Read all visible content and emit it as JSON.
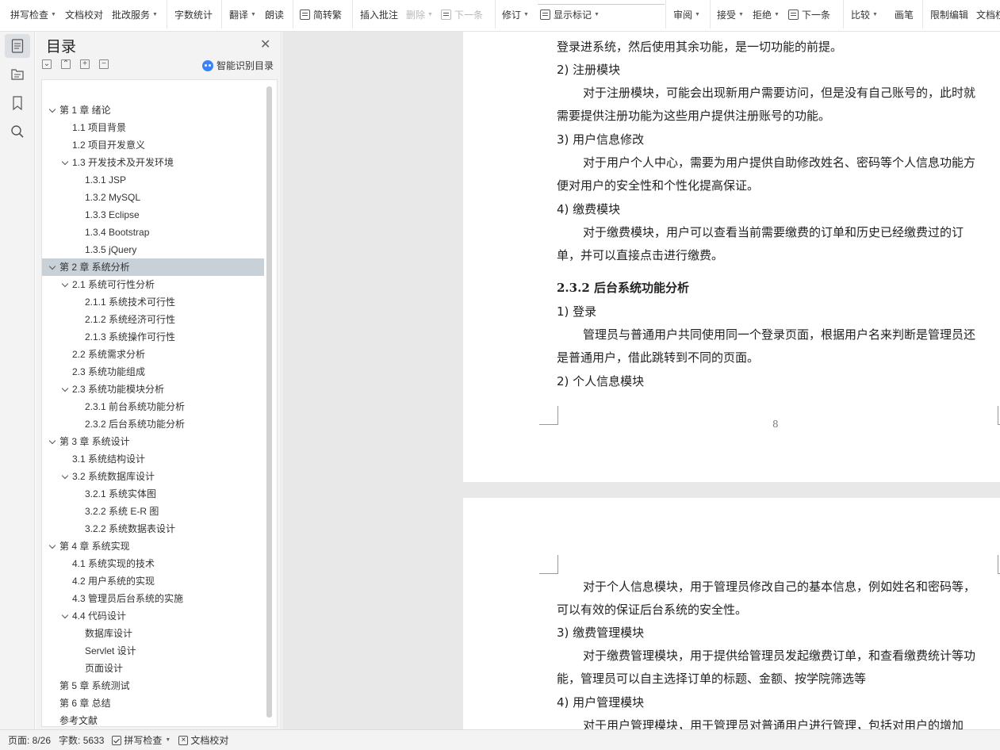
{
  "toolbar": {
    "items": [
      {
        "label": "拼写检查",
        "caret": true,
        "disabled": false
      },
      {
        "label": "文档校对",
        "caret": false,
        "disabled": false
      },
      {
        "label": "批改服务",
        "caret": true,
        "disabled": false
      },
      {
        "label": "字数统计",
        "caret": false,
        "disabled": false
      },
      {
        "label": "翻译",
        "caret": true,
        "disabled": false
      },
      {
        "label": "朗读",
        "caret": false,
        "disabled": false
      },
      {
        "label": "简转繁",
        "caret": false,
        "disabled": false
      },
      {
        "label": "插入批注",
        "caret": false,
        "disabled": false
      },
      {
        "label": "删除",
        "caret": true,
        "disabled": true
      },
      {
        "label": "下一条",
        "caret": false,
        "disabled": true
      },
      {
        "label": "修订",
        "caret": true,
        "disabled": false
      },
      {
        "label": "显示标记",
        "caret": true,
        "disabled": false
      },
      {
        "label": "审阅",
        "caret": true,
        "disabled": false
      },
      {
        "label": "接受",
        "caret": true,
        "disabled": false
      },
      {
        "label": "拒绝",
        "caret": true,
        "disabled": false
      },
      {
        "label": "下一条",
        "caret": false,
        "disabled": false
      },
      {
        "label": "比较",
        "caret": true,
        "disabled": false
      },
      {
        "label": "画笔",
        "caret": false,
        "disabled": false
      },
      {
        "label": "限制编辑",
        "caret": false,
        "disabled": false
      },
      {
        "label": "文档权",
        "caret": false,
        "disabled": false
      }
    ]
  },
  "rail": {
    "icons": [
      "toc-icon",
      "outline-icon",
      "bookmark-icon",
      "search-icon"
    ]
  },
  "toc": {
    "title": "目录",
    "smart_label": "智能识别目录",
    "tools": [
      "⌄",
      "⌃",
      "+",
      "−"
    ],
    "items": [
      {
        "label": "第 1 章  绪论",
        "level": 0,
        "arrow": true,
        "selected": false
      },
      {
        "label": "1.1  项目背景",
        "level": 1,
        "arrow": false,
        "selected": false
      },
      {
        "label": "1.2  项目开发意义",
        "level": 1,
        "arrow": false,
        "selected": false
      },
      {
        "label": "1.3  开发技术及开发环境",
        "level": 1,
        "arrow": true,
        "selected": false
      },
      {
        "label": "1.3.1 JSP",
        "level": 2,
        "arrow": false,
        "selected": false
      },
      {
        "label": "1.3.2    MySQL",
        "level": 2,
        "arrow": false,
        "selected": false
      },
      {
        "label": "1.3.3    Eclipse",
        "level": 2,
        "arrow": false,
        "selected": false
      },
      {
        "label": "1.3.4    Bootstrap",
        "level": 2,
        "arrow": false,
        "selected": false
      },
      {
        "label": "1.3.5    jQuery",
        "level": 2,
        "arrow": false,
        "selected": false
      },
      {
        "label": "第 2 章  系统分析",
        "level": 0,
        "arrow": true,
        "selected": true
      },
      {
        "label": "2.1  系统可行性分析",
        "level": 1,
        "arrow": true,
        "selected": false
      },
      {
        "label": "2.1.1 系统技术可行性",
        "level": 2,
        "arrow": false,
        "selected": false
      },
      {
        "label": "2.1.2 系统经济可行性",
        "level": 2,
        "arrow": false,
        "selected": false
      },
      {
        "label": "2.1.3 系统操作可行性",
        "level": 2,
        "arrow": false,
        "selected": false
      },
      {
        "label": "2.2 系统需求分析",
        "level": 1,
        "arrow": false,
        "selected": false
      },
      {
        "label": "2.3 系统功能组成",
        "level": 1,
        "arrow": false,
        "selected": false
      },
      {
        "label": "2.3    系统功能模块分析",
        "level": 1,
        "arrow": true,
        "selected": false
      },
      {
        "label": "2.3.1    前台系统功能分析",
        "level": 2,
        "arrow": false,
        "selected": false
      },
      {
        "label": "2.3.2    后台系统功能分析",
        "level": 2,
        "arrow": false,
        "selected": false
      },
      {
        "label": "第 3 章  系统设计",
        "level": 0,
        "arrow": true,
        "selected": false
      },
      {
        "label": "3.1  系统结构设计",
        "level": 1,
        "arrow": false,
        "selected": false
      },
      {
        "label": "3.2    系统数据库设计",
        "level": 1,
        "arrow": true,
        "selected": false
      },
      {
        "label": "3.2.1 系统实体图",
        "level": 2,
        "arrow": false,
        "selected": false
      },
      {
        "label": "3.2.2 系统 E-R 图",
        "level": 2,
        "arrow": false,
        "selected": false
      },
      {
        "label": "3.2.2  系统数据表设计",
        "level": 2,
        "arrow": false,
        "selected": false
      },
      {
        "label": "第 4 章  系统实现",
        "level": 0,
        "arrow": true,
        "selected": false
      },
      {
        "label": "4.1  系统实现的技术",
        "level": 1,
        "arrow": false,
        "selected": false
      },
      {
        "label": "4.2  用户系统的实现",
        "level": 1,
        "arrow": false,
        "selected": false
      },
      {
        "label": "4.3  管理员后台系统的实施",
        "level": 1,
        "arrow": false,
        "selected": false
      },
      {
        "label": "4.4  代码设计",
        "level": 1,
        "arrow": true,
        "selected": false
      },
      {
        "label": "数据库设计",
        "level": 2,
        "arrow": false,
        "selected": false
      },
      {
        "label": "Servlet 设计",
        "level": 2,
        "arrow": false,
        "selected": false
      },
      {
        "label": "页面设计",
        "level": 2,
        "arrow": false,
        "selected": false
      },
      {
        "label": "第 5 章  系统测试",
        "level": 0,
        "arrow": false,
        "selected": false
      },
      {
        "label": "第 6 章  总结",
        "level": 0,
        "arrow": false,
        "selected": false
      },
      {
        "label": "参考文献",
        "level": 0,
        "arrow": false,
        "selected": false
      }
    ]
  },
  "doc": {
    "page1": [
      {
        "text": "登录进系统，然后使用其余功能，是一切功能的前提。",
        "indent": false,
        "heading": false
      },
      {
        "text": "2)   注册模块",
        "indent": false,
        "heading": false
      },
      {
        "text": "对于注册模块，可能会出现新用户需要访问，但是没有自己账号的，此时就",
        "indent": true,
        "heading": false
      },
      {
        "text": "需要提供注册功能为这些用户提供注册账号的功能。",
        "indent": false,
        "heading": false
      },
      {
        "text": "3)   用户信息修改",
        "indent": false,
        "heading": false
      },
      {
        "text": "对于用户个人中心，需要为用户提供自助修改姓名、密码等个人信息功能方",
        "indent": true,
        "heading": false
      },
      {
        "text": "便对用户的安全性和个性化提高保证。",
        "indent": false,
        "heading": false
      },
      {
        "text": "4)   缴费模块",
        "indent": false,
        "heading": false
      },
      {
        "text": "对于缴费模块，用户可以查看当前需要缴费的订单和历史已经缴费过的订",
        "indent": true,
        "heading": false
      },
      {
        "text": "单，并可以直接点击进行缴费。",
        "indent": false,
        "heading": false
      },
      {
        "text": "2.3.2    后台系统功能分析",
        "indent": false,
        "heading": true
      },
      {
        "text": "1)   登录",
        "indent": false,
        "heading": false
      },
      {
        "text": "管理员与普通用户共同使用同一个登录页面，根据用户名来判断是管理员还",
        "indent": true,
        "heading": false
      },
      {
        "text": "是普通用户，借此跳转到不同的页面。",
        "indent": false,
        "heading": false
      },
      {
        "text": "2)   个人信息模块",
        "indent": false,
        "heading": false
      }
    ],
    "page_number": "8",
    "page2": [
      {
        "text": "对于个人信息模块，用于管理员修改自己的基本信息，例如姓名和密码等，",
        "indent": true,
        "heading": false
      },
      {
        "text": "可以有效的保证后台系统的安全性。",
        "indent": false,
        "heading": false
      },
      {
        "text": "3)   缴费管理模块",
        "indent": false,
        "heading": false
      },
      {
        "text": "对于缴费管理模块，用于提供给管理员发起缴费订单，和查看缴费统计等功",
        "indent": true,
        "heading": false
      },
      {
        "text": "能，管理员可以自主选择订单的标题、金额、按学院筛选等",
        "indent": false,
        "heading": false
      },
      {
        "text": "4)   用户管理模块",
        "indent": false,
        "heading": false
      },
      {
        "text": "对于用户管理模块，用于管理员对普通用户进行管理，包括对用户的增加",
        "indent": true,
        "heading": false
      }
    ]
  },
  "status": {
    "page": "页面: 8/26",
    "words": "字数: 5633",
    "spell": "拼写检查",
    "proof": "文档校对"
  }
}
